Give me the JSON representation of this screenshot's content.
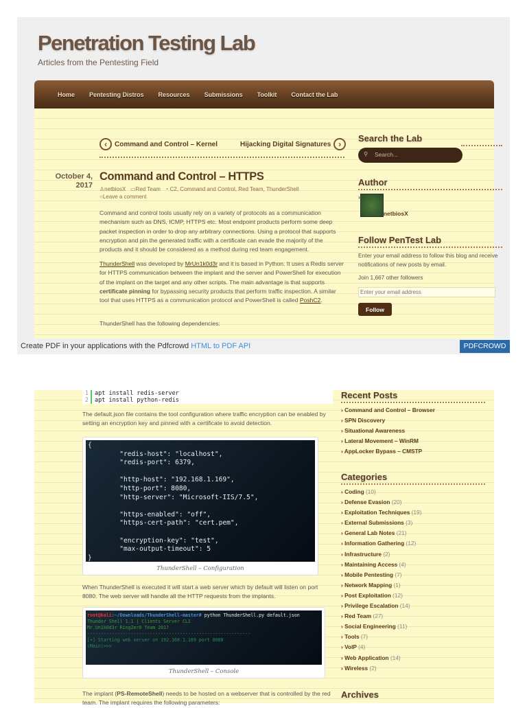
{
  "site": {
    "title": "Penetration Testing Lab",
    "tagline": "Articles from the Pentesting Field"
  },
  "nav": [
    "Home",
    "Pentesting Distros",
    "Resources",
    "Submissions",
    "Toolkit",
    "Contact the Lab"
  ],
  "post_nav": {
    "prev": "Command and Control – Kernel",
    "next": "Hijacking Digital Signatures"
  },
  "post": {
    "date_line1": "October 4,",
    "date_line2": "2017",
    "title": "Command and Control – HTTPS",
    "author": "netbiosX",
    "category": "Red Team",
    "tags": "C2, Command and Control, Red Team, ThunderShell",
    "comment": "Leave a comment",
    "p1": "Command and control tools usually rely on a variety of protocols as a communication mechanism such as DNS, ICMP, HTTPS etc. Most endpoint products perform some deep packet inspection in order to drop any arbitrary connections. Using a protocol that supports encryption and pin the generated traffic with a certificate can evade the majority of the products and it should be considered as a method during red team engagement.",
    "p2": {
      "link1": "ThunderShell",
      "t1": " was developed by ",
      "link2": "MrUn1k0d3r",
      "t2": " and it is based in Python. It uses a Redis server for HTTPS communication between the implant and the server and PowerShell for execution of the implant on the target and any other scripts. The main advantage is that supports ",
      "bold": "certificate pinning",
      "t3": " for bypassing security products that perform traffic inspection. A similar tool that uses HTTPS as a communication protocol and PowerShell is called ",
      "link3": "PoshC2",
      "t4": "."
    },
    "p3": "ThunderShell has the following dependencies:",
    "code": [
      {
        "n": "1",
        "line": "apt install redis-server"
      },
      {
        "n": "2",
        "line": "apt install python-redis"
      }
    ],
    "p4": "The default.json file contains the tool configuration where traffic encryption can be enabled by setting an encryption key and pinned with a certificate to avoid detection.",
    "config": "{\n        \"redis-host\": \"localhost\",\n        \"redis-port\": 6379,\n\n        \"http-host\": \"192.168.1.169\",\n        \"http-port\": 8080,\n        \"http-server\": \"Microsoft-IIS/7.5\",\n\n        \"https-enabled\": \"off\",\n        \"https-cert-path\": \"cert.pem\",\n\n        \"encryption-key\": \"test\",\n        \"max-output-timeout\": 5\n}",
    "config_caption": "ThunderShell – Configuration",
    "p5": "When ThunderShell is executed it will start a web server which by default will listen on port 8080. The web server will handle all the HTTP requests from the implants.",
    "console": {
      "prompt_user": "root@kali",
      "prompt_path": ":~/Downloads/ThunderShell-master#",
      "cmd": " python ThunderShell.py default.json",
      "l1": "Thunder Shell 1.1 | Clients Server CLI",
      "l2": "Mr.Un1k0d3r RingZer0 Team 2017",
      "l3": "------------------------------------------------------------",
      "l4": "[+] Starting web server on 192.168.1.169 port 8080",
      "l5": "(Main)>>>"
    },
    "console_caption": "ThunderShell – Console",
    "p6_a": "The implant (",
    "p6_b": "PS-RemoteShell",
    "p6_c": ") needs to be hosted on a webserver that is controlled by the red team. The implant requires the following parameters:"
  },
  "sidebar": {
    "search_title": "Search the Lab",
    "search_placeholder": "Search...",
    "author_title": "Author",
    "author_name": "netbiosX",
    "follow_title": "Follow PenTest Lab",
    "follow_text": "Enter your email address to follow this blog and receive notifications of new posts by email.",
    "followers": "Join 1,667 other followers",
    "email_placeholder": "Enter your email address",
    "follow_button": "Follow",
    "recent_title": "Recent Posts",
    "recent": [
      "Command and Control – Browser",
      "SPN Discovery",
      "Situational Awareness",
      "Lateral Movement – WinRM",
      "AppLocker Bypass – CMSTP"
    ],
    "categories_title": "Categories",
    "categories": [
      {
        "name": "Coding",
        "count": "(10)"
      },
      {
        "name": "Defense Evasion",
        "count": "(20)"
      },
      {
        "name": "Exploitation Techniques",
        "count": "(19)"
      },
      {
        "name": "External Submissions",
        "count": "(3)"
      },
      {
        "name": "General Lab Notes",
        "count": "(21)"
      },
      {
        "name": "Information Gathering",
        "count": "(12)"
      },
      {
        "name": "Infrastructure",
        "count": "(2)"
      },
      {
        "name": "Maintaining Access",
        "count": "(4)"
      },
      {
        "name": "Mobile Pentesting",
        "count": "(7)"
      },
      {
        "name": "Network Mapping",
        "count": "(1)"
      },
      {
        "name": "Post Exploitation",
        "count": "(12)"
      },
      {
        "name": "Privilege Escalation",
        "count": "(14)"
      },
      {
        "name": "Red Team",
        "count": "(27)"
      },
      {
        "name": "Social Engineering",
        "count": "(11)"
      },
      {
        "name": "Tools",
        "count": "(7)"
      },
      {
        "name": "VoIP",
        "count": "(4)"
      },
      {
        "name": "Web Application",
        "count": "(14)"
      },
      {
        "name": "Wireless",
        "count": "(2)"
      }
    ],
    "archives_title": "Archives"
  },
  "pdfcrowd": {
    "text": "Create PDF in your applications with the Pdfcrowd ",
    "link": "HTML to PDF API",
    "button": "PDFCROWD"
  }
}
